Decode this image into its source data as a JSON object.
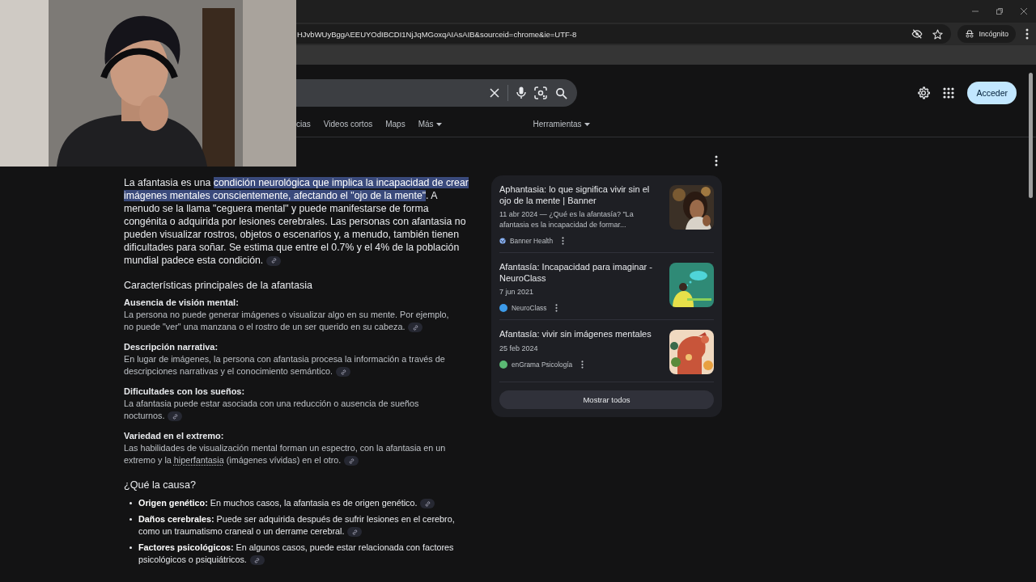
{
  "browser": {
    "address": "HJvbWUyBggAEEUYOdIBCDI1NjJqMGoxqAIAsAIB&sourceid=chrome&ie=UTF-8",
    "incognito": "Incógnito"
  },
  "search": {
    "tabs": [
      {
        "label": "cias",
        "selected": false
      },
      {
        "label": "Videos cortos",
        "selected": false
      },
      {
        "label": "Maps",
        "selected": false
      },
      {
        "label": "Más",
        "selected": false,
        "kind": "menu"
      }
    ],
    "tools": "Herramientas",
    "sign_in": "Acceder"
  },
  "overview": {
    "intro": {
      "before": "La afantasia es una ",
      "highlighted": "condición neurológica que implica la incapacidad de crear imágenes mentales conscientemente, afectando el \"ojo de la mente\"",
      "after": ". A menudo se la llama \"ceguera mental\" y puede manifestarse de forma congénita o adquirida por lesiones cerebrales. Las personas con afantasia no pueden visualizar rostros, objetos o escenarios y, a menudo, también tienen dificultades para soñar. Se estima que entre el 0.7% y el 4% de la población mundial padece esta condición."
    },
    "heading": "Características principales de la afantasia",
    "features": [
      {
        "title": "Ausencia de visión mental:",
        "text": "La persona no puede generar imágenes o visualizar algo en su mente. Por ejemplo, no puede \"ver\" una manzana o el rostro de un ser querido en su cabeza."
      },
      {
        "title": "Descripción narrativa:",
        "text": "En lugar de imágenes, la persona con afantasia procesa la información a través de descripciones narrativas y el conocimiento semántico."
      },
      {
        "title": "Dificultades con los sueños:",
        "text": "La afantasia puede estar asociada con una reducción o ausencia de sueños nocturnos."
      },
      {
        "title": "Variedad en el extremo:",
        "text": "Las habilidades de visualización mental forman un espectro, con la afantasia en un extremo y la ",
        "link": "hiperfantasia",
        "text_after": " (imágenes vívidas) en el otro."
      }
    ],
    "cause_heading": "¿Qué la causa?",
    "causes": [
      {
        "text": "**Origen genético:** En muchos casos, la afantasia es de origen genético."
      },
      {
        "text": "**Daños cerebrales:** Puede ser adquirida después de sufrir lesiones en el cerebro, como un traumatismo craneal o un derrame cerebral."
      },
      {
        "text": "**Factores psicológicos:** En algunos casos, puede estar relacionada con factores psicológicos o psiquiátricos."
      }
    ]
  },
  "sources": {
    "items": [
      {
        "title": "Aphantasia: lo que significa vivir sin el ojo de la mente | Banner",
        "snippet": "11 abr 2024 — ¿Qué es la afantasía? \"La afantasia es la incapacidad de formar...",
        "site": "Banner Health",
        "kind": "globe",
        "color": "#8ab4f8"
      },
      {
        "title": "Afantasía: Incapacidad para imaginar - NeuroClass",
        "date": "7 jun 2021",
        "site": "NeuroClass",
        "kind": "logo",
        "color": "#3d9be9"
      },
      {
        "title": "Afantasía: vivir sin imágenes mentales",
        "date": "25 feb 2024",
        "site": "enGrama Psicología",
        "kind": "logo",
        "color": "#5bb974"
      }
    ],
    "show_all": "Mostrar todos"
  }
}
